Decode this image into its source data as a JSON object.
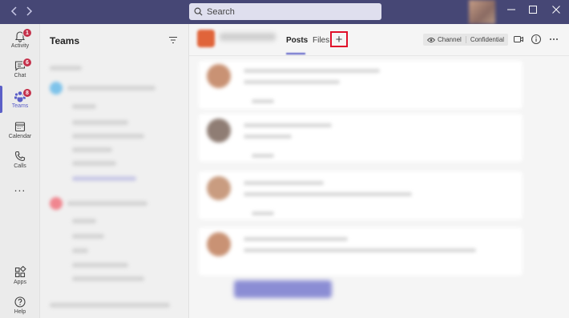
{
  "titlebar": {
    "search_placeholder": "Search",
    "icons": [
      "back-icon",
      "forward-icon",
      "search-icon",
      "minimize-icon",
      "maximize-icon",
      "close-icon"
    ]
  },
  "rail": {
    "items": [
      {
        "label": "Activity",
        "badge": "1",
        "icon": "bell-icon"
      },
      {
        "label": "Chat",
        "badge": "6",
        "icon": "chat-icon"
      },
      {
        "label": "Teams",
        "badge": "8",
        "icon": "teams-icon",
        "active": true
      },
      {
        "label": "Calendar",
        "icon": "calendar-icon"
      },
      {
        "label": "Calls",
        "icon": "phone-icon"
      },
      {
        "label": "...",
        "icon": "more-icon"
      },
      {
        "label": "Apps",
        "icon": "apps-icon"
      },
      {
        "label": "Help",
        "icon": "help-icon"
      }
    ]
  },
  "teams_panel": {
    "title": "Teams"
  },
  "channel_header": {
    "tabs": [
      {
        "label": "Posts",
        "active": true
      },
      {
        "label": "Files"
      }
    ],
    "add_tab_symbol": "+",
    "channel_label": "Channel",
    "confidential_label": "Confidential"
  },
  "colors": {
    "titlebar": "#464775",
    "accent": "#5b5fc7",
    "badge": "#c4314b",
    "highlight": "#e0102a"
  }
}
